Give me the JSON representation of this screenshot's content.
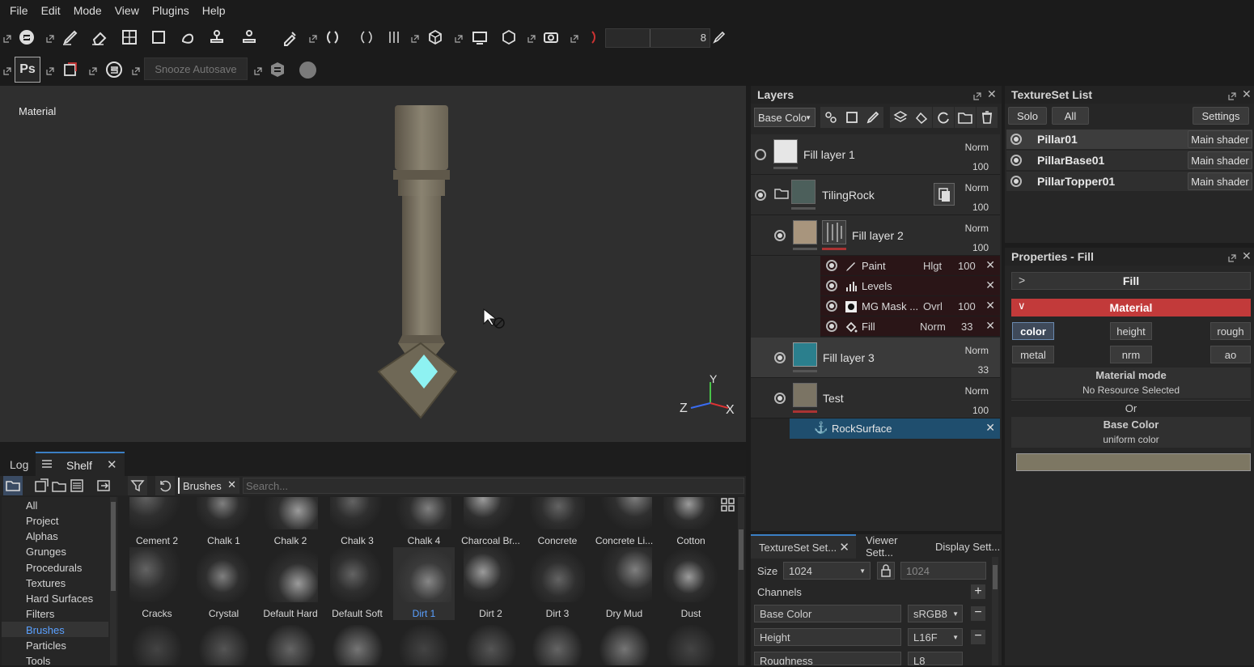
{
  "menu": [
    "File",
    "Edit",
    "Mode",
    "View",
    "Plugins",
    "Help"
  ],
  "toolbar": {
    "slider_value": "8",
    "autosave_label": "Snooze Autosave",
    "ps_label": "Ps"
  },
  "viewport": {
    "label": "Material",
    "axis_x": "X",
    "axis_y": "Y",
    "axis_z": "Z"
  },
  "layers": {
    "title": "Layers",
    "channel_select": "Base Colo",
    "items": [
      {
        "name": "Fill layer 1",
        "blend": "Norm",
        "opacity": "100"
      },
      {
        "name": "TilingRock",
        "blend": "Norm",
        "opacity": "100"
      },
      {
        "name": "Fill layer 2",
        "blend": "Norm",
        "opacity": "100"
      },
      {
        "name": "Fill layer 3",
        "blend": "Norm",
        "opacity": "33"
      },
      {
        "name": "Test",
        "blend": "Norm",
        "opacity": "100"
      }
    ],
    "effects": [
      {
        "name": "Paint",
        "blend": "Hlgt",
        "opacity": "100"
      },
      {
        "name": "Levels",
        "blend": "",
        "opacity": ""
      },
      {
        "name": "MG Mask ...",
        "blend": "Ovrl",
        "opacity": "100"
      },
      {
        "name": "Fill",
        "blend": "Norm",
        "opacity": "33"
      }
    ],
    "anchor": "RockSurface"
  },
  "textureset_list": {
    "title": "TextureSet List",
    "solo": "Solo",
    "all": "All",
    "settings": "Settings",
    "items": [
      {
        "name": "Pillar01",
        "shader": "Main shader"
      },
      {
        "name": "PillarBase01",
        "shader": "Main shader"
      },
      {
        "name": "PillarTopper01",
        "shader": "Main shader"
      }
    ]
  },
  "properties": {
    "title": "Properties - Fill",
    "fill": "Fill",
    "material": "Material",
    "channels": [
      "color",
      "height",
      "rough",
      "metal",
      "nrm",
      "ao"
    ],
    "mode_title": "Material mode",
    "mode_value": "No Resource Selected",
    "or": "Or",
    "base_color_title": "Base Color",
    "base_color_value": "uniform color",
    "swatch_color": "#7d7763"
  },
  "bottom": {
    "tab_log": "Log",
    "tab_shelf": "Shelf",
    "filter_tag": "Brushes",
    "search_placeholder": "Search...",
    "categories": [
      "All",
      "Project",
      "Alphas",
      "Grunges",
      "Procedurals",
      "Textures",
      "Hard Surfaces",
      "Filters",
      "Brushes",
      "Particles",
      "Tools"
    ],
    "brushes_row1": [
      "Cement 2",
      "Chalk 1",
      "Chalk 2",
      "Chalk 3",
      "Chalk 4",
      "Charcoal Br...",
      "Concrete",
      "Concrete Li...",
      "Cotton"
    ],
    "brushes_row2": [
      "Cracks",
      "Crystal",
      "Default Hard",
      "Default Soft",
      "Dirt 1",
      "Dirt 2",
      "Dirt 3",
      "Dry Mud",
      "Dust"
    ]
  },
  "textureset_settings": {
    "tabs": [
      "TextureSet Set...",
      "Viewer Sett...",
      "Display Sett..."
    ],
    "size_label": "Size",
    "size_value": "1024",
    "size_value2": "1024",
    "channels_label": "Channels",
    "channels": [
      {
        "name": "Base Color",
        "format": "sRGB8"
      },
      {
        "name": "Height",
        "format": "L16F"
      },
      {
        "name": "Roughness",
        "format": "L8"
      }
    ]
  },
  "colors": {
    "accent": "#c23a3a",
    "selection": "#1f4e6e",
    "highlight": "#5aa0ff"
  }
}
